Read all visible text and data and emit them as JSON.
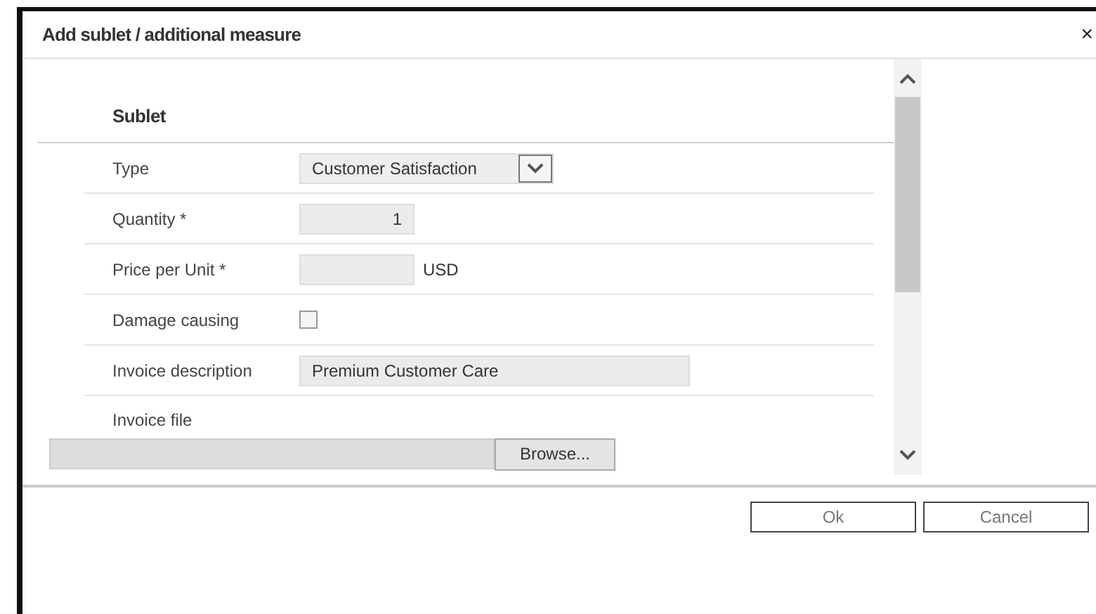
{
  "dialog": {
    "title": "Add sublet / additional measure",
    "close": "×"
  },
  "section": {
    "title": "Sublet"
  },
  "fields": [
    {
      "kind": "select",
      "label": "Type",
      "value": "Customer Satisfaction"
    },
    {
      "kind": "number",
      "label": "Quantity *",
      "value": "1"
    },
    {
      "kind": "unit",
      "label": "Price per Unit *",
      "unit": "USD"
    },
    {
      "kind": "checkbox",
      "label": "Damage causing",
      "checked": false
    },
    {
      "kind": "text",
      "label": "Invoice description",
      "value": "Premium Customer Care"
    },
    {
      "kind": "file",
      "label": "Invoice file",
      "button": "Browse..."
    }
  ],
  "buttons": [
    "Ok",
    "Cancel"
  ]
}
